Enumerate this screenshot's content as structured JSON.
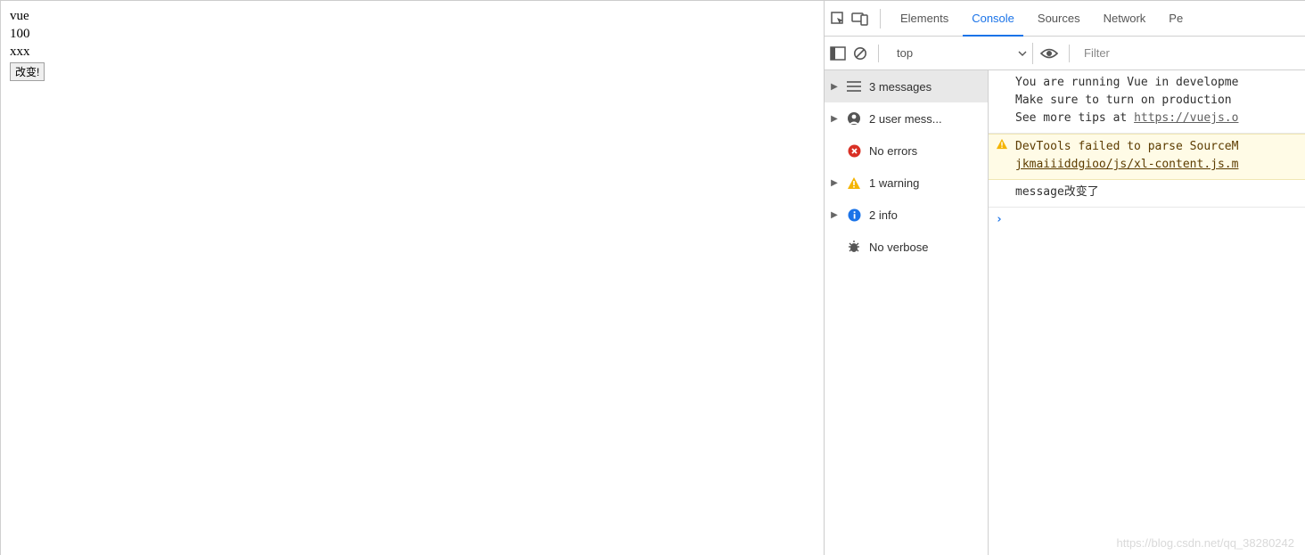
{
  "page": {
    "line1": "vue",
    "line2": "100",
    "line3": "xxx",
    "button_label": "改变!"
  },
  "devtools": {
    "tabs": {
      "elements": "Elements",
      "console": "Console",
      "sources": "Sources",
      "network": "Network",
      "more": "Pe"
    },
    "active_tab": "console",
    "toolbar": {
      "scope": "top",
      "filter_placeholder": "Filter"
    },
    "sidebar": {
      "messages": "3 messages",
      "user_messages": "2 user mess...",
      "no_errors": "No errors",
      "warning": "1 warning",
      "info": "2 info",
      "no_verbose": "No verbose"
    },
    "logs": {
      "msg1_l1": "You are running Vue in developme",
      "msg1_l2": "Make sure to turn on production ",
      "msg1_l3_prefix": "See more tips at ",
      "msg1_l3_link": "https://vuejs.o",
      "warn_l1": "DevTools failed to parse SourceM",
      "warn_l2": "jkmaiiiddgioo/js/xl-content.js.m",
      "msg3": "message改变了"
    }
  },
  "watermark": "https://blog.csdn.net/qq_38280242"
}
